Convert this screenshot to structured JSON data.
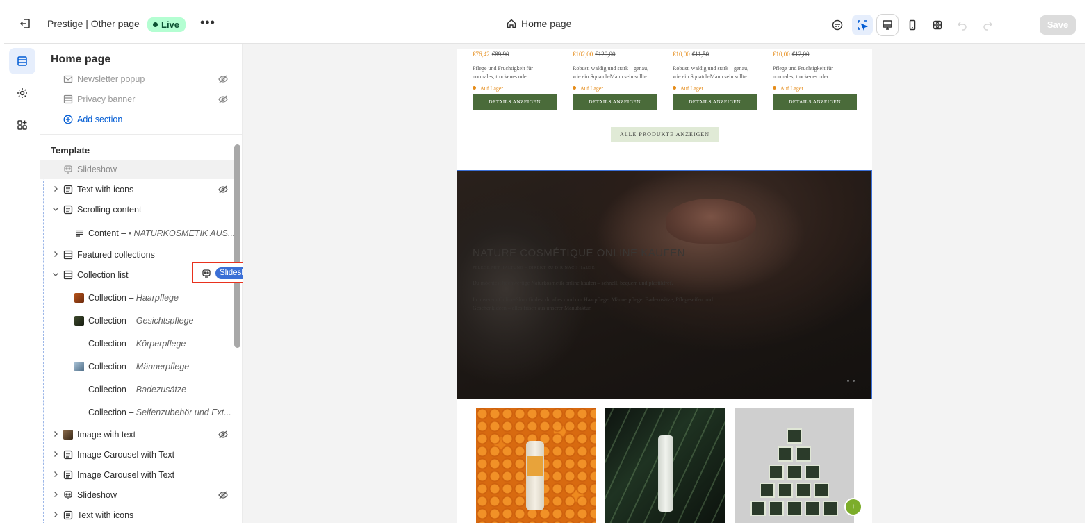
{
  "topbar": {
    "theme_name": "Prestige | Other page",
    "status": "Live",
    "more": "•••",
    "page_name": "Home page",
    "save_label": "Save"
  },
  "panel": {
    "title": "Home page",
    "header_items": [
      {
        "label": "Newsletter popup",
        "hidden": true
      },
      {
        "label": "Privacy banner",
        "hidden": true
      }
    ],
    "add_section": "Add section",
    "template_heading": "Template",
    "items": [
      {
        "label": "Slideshow",
        "state": "dragging"
      },
      {
        "label": "Text with icons",
        "hidden": true
      },
      {
        "label": "Scrolling content",
        "expanded": true
      },
      {
        "label": "Content – ",
        "detail": "• NATURKOSMETIK AUS..."
      },
      {
        "label": "Featured collections"
      },
      {
        "label": "Collection list",
        "expanded": true
      },
      {
        "label": "Collection – ",
        "detail": "Haarpflege"
      },
      {
        "label": "Collection – ",
        "detail": "Gesichtspflege"
      },
      {
        "label": "Collection – ",
        "detail": "Körperpflege"
      },
      {
        "label": "Collection – ",
        "detail": "Männerpflege"
      },
      {
        "label": "Collection – ",
        "detail": "Badezusätze"
      },
      {
        "label": "Collection – ",
        "detail": "Seifenzubehör und Ext..."
      },
      {
        "label": "Image with text",
        "hidden": true
      },
      {
        "label": "Image Carousel with Text"
      },
      {
        "label": "Image Carousel with Text"
      },
      {
        "label": "Slideshow",
        "hidden": true
      },
      {
        "label": "Text with icons"
      }
    ]
  },
  "drag_tooltip": {
    "label": "Slideshow"
  },
  "preview": {
    "products": [
      {
        "price": "€76,42",
        "compare": "€89,90",
        "desc1": "Pflege und Fruchtigkeit für",
        "desc2": "normales, trockenes oder...",
        "stock": "Auf Lager",
        "button": "DETAILS ANZEIGEN"
      },
      {
        "price": "€102,00",
        "compare": "€120,00",
        "desc1": "Robust, waldig und stark – genau,",
        "desc2": "wie ein Squatch-Mann sein sollte",
        "stock": "Auf Lager",
        "button": "DETAILS ANZEIGEN"
      },
      {
        "price": "€10,00",
        "compare": "€11,50",
        "desc1": "Robust, waldig und stark – genau,",
        "desc2": "wie ein Squatch-Mann sein sollte",
        "stock": "Auf Lager",
        "button": "DETAILS ANZEIGEN"
      },
      {
        "price": "€10,00",
        "compare": "€12,00",
        "desc1": "Pflege und Fruchtigkeit für",
        "desc2": "normales, trockenes oder...",
        "stock": "Auf Lager",
        "button": "DETAILS ANZEIGEN"
      }
    ],
    "all_products": "ALLE PRODUKTE ANZEIGEN",
    "hero": {
      "title": "NATURE COSMÉTIQUE ONLINE KAUFEN",
      "subtitle": "PFLEGE MIT HALTUNG – DIREKT ZU DIR NACH HAUSE",
      "para1": "Du möchtest hochwertige Naturkosmetik online kaufen – schnell, bequem und plastikfrei?",
      "para2": "In unserem Online-Shop findest du alles rund um Haarpflege, Männerpflege, Badezusätze, Pflegeseifen und Geschenkideen – alles frisch aus unserer Manufaktur."
    }
  }
}
